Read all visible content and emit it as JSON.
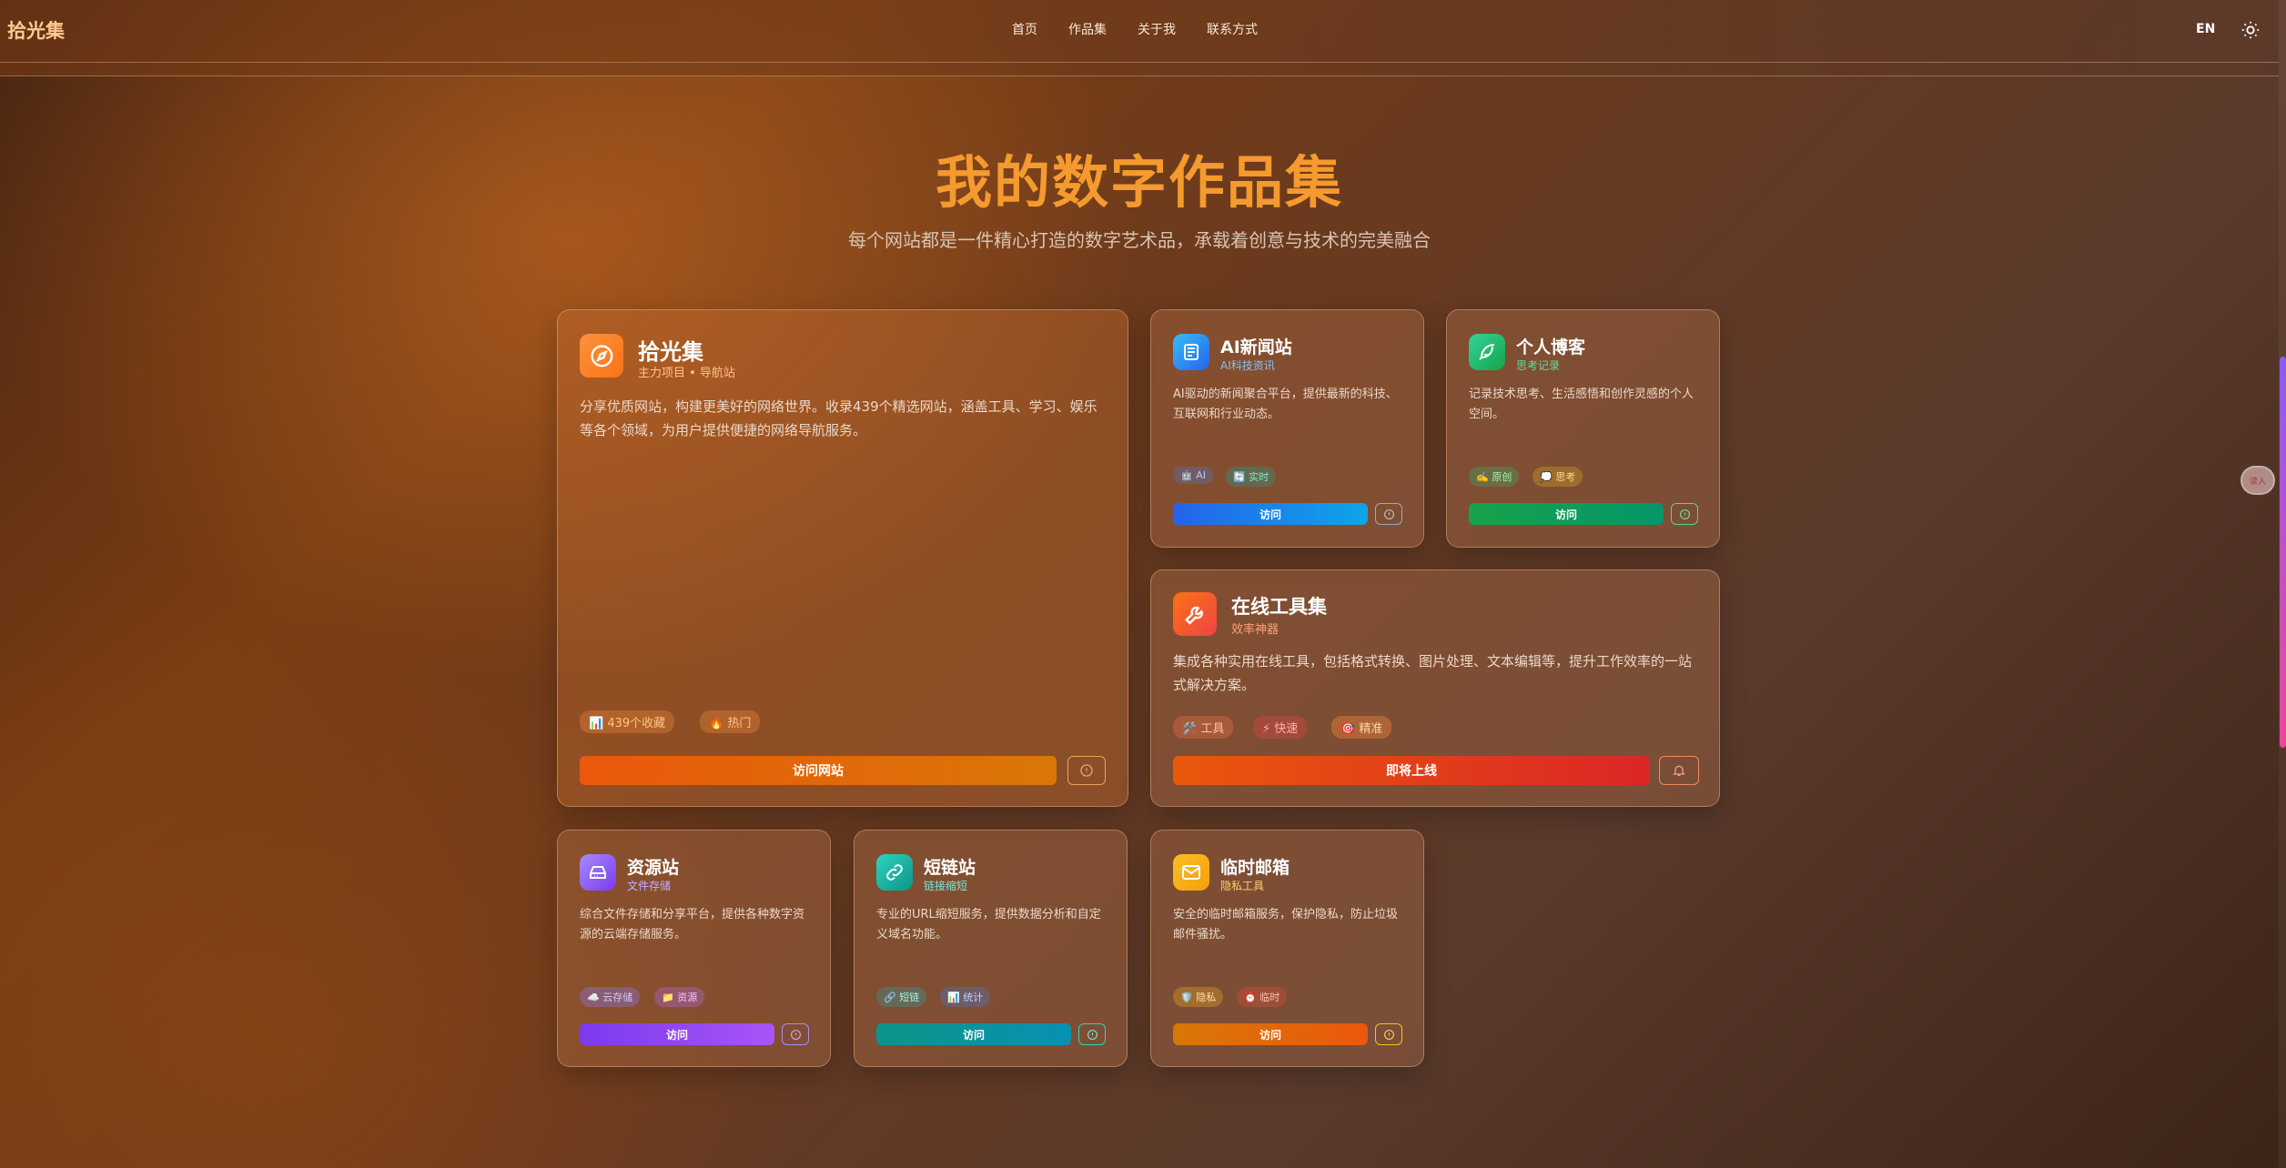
{
  "header": {
    "logo": "拾光集",
    "nav": [
      "首页",
      "作品集",
      "关于我",
      "联系方式"
    ],
    "lang": "EN"
  },
  "hero": {
    "title": "我的数字作品集",
    "subtitle": "每个网站都是一件精心打造的数字艺术品，承载着创意与技术的完美融合"
  },
  "cards": {
    "shiguangji": {
      "title": "拾光集",
      "subtitle": "主力项目 • 导航站",
      "desc": "分享优质网站，构建更美好的网络世界。收录439个精选网站，涵盖工具、学习、娱乐等各个领域，为用户提供便捷的网络导航服务。",
      "tags": [
        "📊 439个收藏",
        "🔥 热门"
      ],
      "button": "访问网站",
      "color": "#f08a1c"
    },
    "ainews": {
      "title": "AI新闻站",
      "subtitle": "AI科技资讯",
      "desc": "AI驱动的新闻聚合平台，提供最新的科技、互联网和行业动态。",
      "tags": [
        "🤖 AI",
        "🔄 实时"
      ],
      "button": "访问",
      "color": "#2e7fe0"
    },
    "blog": {
      "title": "个人博客",
      "subtitle": "思考记录",
      "desc": "记录技术思考、生活感悟和创作灵感的个人空间。",
      "tags": [
        "✍️ 原创",
        "💭 思考"
      ],
      "button": "访问",
      "color": "#1fb86a"
    },
    "tools": {
      "title": "在线工具集",
      "subtitle": "效率神器",
      "desc": "集成各种实用在线工具，包括格式转换、图片处理、文本编辑等，提升工作效率的一站式解决方案。",
      "tags": [
        "🛠️ 工具",
        "⚡ 快速",
        "🎯 精准"
      ],
      "button": "即将上线",
      "color": "#f25a2a"
    },
    "resources": {
      "title": "资源站",
      "subtitle": "文件存储",
      "desc": "综合文件存储和分享平台，提供各种数字资源的云端存储服务。",
      "tags": [
        "☁️ 云存储",
        "📁 资源"
      ],
      "button": "访问",
      "color": "#8b5cf6"
    },
    "shortlink": {
      "title": "短链站",
      "subtitle": "链接缩短",
      "desc": "专业的URL缩短服务，提供数据分析和自定义域名功能。",
      "tags": [
        "🔗 短链",
        "📊 统计"
      ],
      "button": "访问",
      "color": "#14b8a6"
    },
    "tempmail": {
      "title": "临时邮箱",
      "subtitle": "隐私工具",
      "desc": "安全的临时邮箱服务，保护隐私，防止垃圾邮件骚扰。",
      "tags": [
        "🛡️ 隐私",
        "⏰ 临时"
      ],
      "button": "访问",
      "color": "#f59e0b"
    }
  },
  "float_badge": "读入"
}
